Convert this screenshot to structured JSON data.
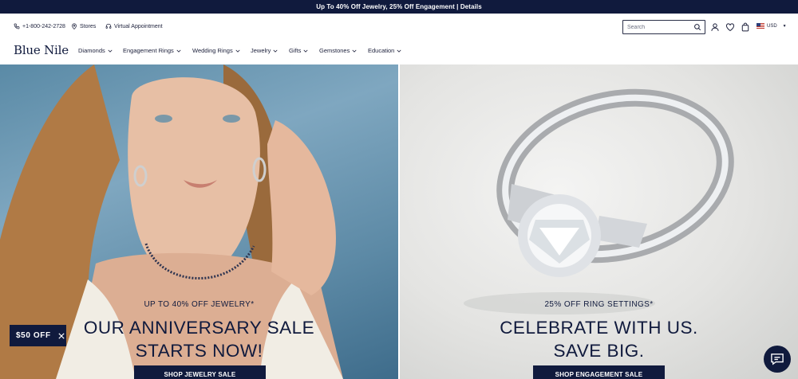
{
  "promo_bar": {
    "text": "Up To 40% Off Jewelry, 25% Off Engagement | Details"
  },
  "utility": {
    "phone": "+1-800-242-2728",
    "stores": "Stores",
    "appointment": "Virtual Appointment",
    "search_placeholder": "Search",
    "currency": "USD"
  },
  "nav": {
    "logo": "Blue Nile",
    "items": [
      {
        "label": "Diamonds"
      },
      {
        "label": "Engagement Rings"
      },
      {
        "label": "Wedding Rings"
      },
      {
        "label": "Jewelry"
      },
      {
        "label": "Gifts"
      },
      {
        "label": "Gemstones"
      },
      {
        "label": "Education"
      }
    ]
  },
  "hero_left": {
    "eyebrow": "UP TO 40% OFF JEWELRY*",
    "headline_line1": "OUR ANNIVERSARY SALE",
    "headline_line2": "STARTS NOW!",
    "cta": "SHOP JEWELRY SALE"
  },
  "hero_right": {
    "eyebrow": "25% OFF RING SETTINGS*",
    "headline_line1": "CELEBRATE WITH US.",
    "headline_line2": "SAVE BIG.",
    "cta": "SHOP ENGAGEMENT SALE"
  },
  "offer_badge": {
    "label": "$50 OFF"
  },
  "colors": {
    "navy": "#101a3d",
    "text": "#1b1f3a"
  }
}
